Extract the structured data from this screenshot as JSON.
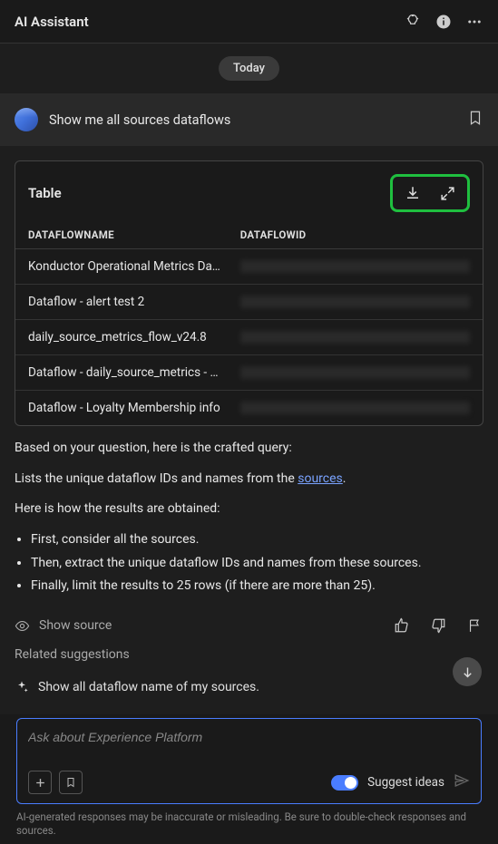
{
  "header": {
    "title": "AI Assistant"
  },
  "date_label": "Today",
  "user_message": "Show me all sources dataflows",
  "table": {
    "title": "Table",
    "columns": {
      "name": "DATAFLOWNAME",
      "id": "DATAFLOWID"
    },
    "rows": [
      {
        "name": "Konductor Operational Metrics Da…"
      },
      {
        "name": "Dataflow - alert test 2"
      },
      {
        "name": "daily_source_metrics_flow_v24.8"
      },
      {
        "name": "Dataflow - daily_source_metrics - …"
      },
      {
        "name": "Dataflow - Loyalty Membership info"
      }
    ]
  },
  "explain": {
    "intro": "Based on your question, here is the crafted query:",
    "summary_pre": "Lists the unique dataflow IDs and names from the ",
    "summary_link": "sources",
    "summary_post": ".",
    "how_title": "Here is how the results are obtained:",
    "steps": [
      "First, consider all the sources.",
      "Then, extract the unique dataflow IDs and names from these sources.",
      "Finally, limit the results to 25 rows (if there are more than 25)."
    ]
  },
  "show_source_label": "Show source",
  "related": {
    "title": "Related suggestions",
    "items": [
      "Show all dataflow name of my sources."
    ]
  },
  "input": {
    "placeholder": "Ask about Experience Platform",
    "suggest_label": "Suggest ideas"
  },
  "disclaimer": "AI-generated responses may be inaccurate or misleading. Be sure to double-check responses and sources."
}
